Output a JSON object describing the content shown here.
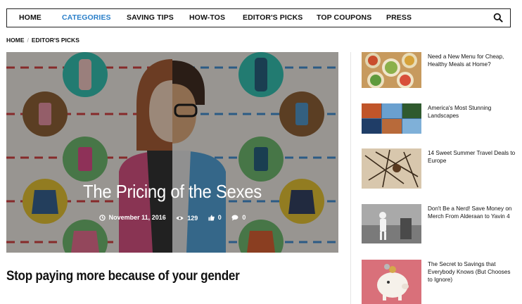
{
  "nav": {
    "items": [
      {
        "label": "HOME",
        "active": false
      },
      {
        "label": "CATEGORIES",
        "active": true
      },
      {
        "label": "SAVING TIPS",
        "active": false
      },
      {
        "label": "HOW-TOS",
        "active": false
      },
      {
        "label": "EDITOR'S PICKS",
        "active": false
      },
      {
        "label": "TOP COUPONS",
        "active": false
      },
      {
        "label": "PRESS",
        "active": false
      }
    ],
    "search_icon": "search-icon"
  },
  "breadcrumb": {
    "home": "HOME",
    "separator": "/",
    "current": "EDITOR'S PICKS"
  },
  "hero": {
    "title": "The Pricing of the Sexes",
    "date": "November 11, 2016",
    "views": "129",
    "likes": "0",
    "comments": "0"
  },
  "article": {
    "headline": "Stop paying more because of your gender"
  },
  "sidebar": {
    "items": [
      {
        "title": "Need a New Menu for Cheap, Healthy Meals at Home?"
      },
      {
        "title": "America's Most Stunning Landscapes"
      },
      {
        "title": "14 Sweet Summer Travel Deals to Europe"
      },
      {
        "title": "Don't Be a Nerd! Save Money on Merch From Alderaan to Yavin 4"
      },
      {
        "title": "The Secret to Savings that Everybody Knows (But Chooses to Ignore)"
      }
    ]
  },
  "colors": {
    "accent": "#2a7fc9",
    "text": "#111111"
  }
}
